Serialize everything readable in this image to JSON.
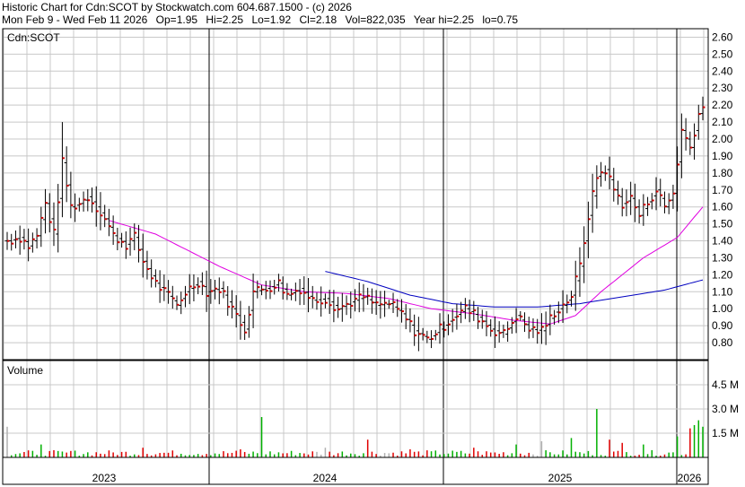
{
  "header": {
    "title": "Historic Chart for Cdn:SCOT by Stockwatch.com 604.687.1500 - (c) 2026",
    "date_range": "Mon Feb  9 - Wed Feb 11 2026",
    "stats": [
      "Op=1.95",
      "Hi=2.25",
      "Lo=1.92",
      "Cl=2.18",
      "Vol=822,035",
      "Year hi=2.25",
      "lo=0.75"
    ]
  },
  "colors": {
    "grid": "#c8c8c8",
    "bar": "#000000",
    "close_tick": "#d00000",
    "ma_short": "#e000e0",
    "ma_long": "#0000c0",
    "volume_up": "#00b000",
    "volume_down": "#e00000",
    "volume_flat": "#b0b0b0"
  },
  "chart_data": [
    {
      "type": "ohlc",
      "label": "Cdn:SCOT",
      "x_labels": [
        "2023",
        "2024",
        "2025",
        "2026"
      ],
      "ylim": [
        0.7,
        2.65
      ],
      "y_ticks": [
        "0.80",
        "0.90",
        "1.00",
        "1.10",
        "1.20",
        "1.30",
        "1.40",
        "1.50",
        "1.60",
        "1.70",
        "1.80",
        "1.90",
        "2.00",
        "2.10",
        "2.20",
        "2.30",
        "2.40",
        "2.50",
        "2.60"
      ],
      "grid": true,
      "bar_count": 165,
      "close_anchors": [
        [
          0,
          1.4
        ],
        [
          3,
          1.42
        ],
        [
          5,
          1.37
        ],
        [
          7,
          1.43
        ],
        [
          9,
          1.62
        ],
        [
          11,
          1.44
        ],
        [
          13,
          1.86
        ],
        [
          15,
          1.6
        ],
        [
          17,
          1.62
        ],
        [
          19,
          1.66
        ],
        [
          21,
          1.6
        ],
        [
          23,
          1.53
        ],
        [
          25,
          1.43
        ],
        [
          28,
          1.38
        ],
        [
          30,
          1.42
        ],
        [
          32,
          1.28
        ],
        [
          35,
          1.15
        ],
        [
          37,
          1.1
        ],
        [
          40,
          1.02
        ],
        [
          42,
          1.1
        ],
        [
          45,
          1.16
        ],
        [
          47,
          1.1
        ],
        [
          50,
          1.12
        ],
        [
          53,
          1.0
        ],
        [
          56,
          0.88
        ],
        [
          58,
          1.1
        ],
        [
          61,
          1.12
        ],
        [
          64,
          1.15
        ],
        [
          66,
          1.08
        ],
        [
          69,
          1.12
        ],
        [
          72,
          1.05
        ],
        [
          75,
          1.06
        ],
        [
          78,
          1.0
        ],
        [
          81,
          1.04
        ],
        [
          84,
          1.07
        ],
        [
          87,
          1.02
        ],
        [
          90,
          1.03
        ],
        [
          93,
          0.97
        ],
        [
          96,
          0.87
        ],
        [
          99,
          0.82
        ],
        [
          102,
          0.88
        ],
        [
          105,
          0.95
        ],
        [
          108,
          1.0
        ],
        [
          111,
          0.95
        ],
        [
          114,
          0.88
        ],
        [
          117,
          0.85
        ],
        [
          120,
          0.96
        ],
        [
          123,
          0.88
        ],
        [
          126,
          0.87
        ],
        [
          129,
          0.98
        ],
        [
          131,
          1.02
        ],
        [
          133,
          1.08
        ],
        [
          135,
          1.25
        ],
        [
          137,
          1.55
        ],
        [
          139,
          1.78
        ],
        [
          141,
          1.82
        ],
        [
          143,
          1.7
        ],
        [
          145,
          1.62
        ],
        [
          147,
          1.65
        ],
        [
          149,
          1.55
        ],
        [
          151,
          1.63
        ],
        [
          153,
          1.7
        ],
        [
          155,
          1.6
        ],
        [
          157,
          1.68
        ],
        [
          159,
          2.05
        ],
        [
          161,
          1.95
        ],
        [
          163,
          2.15
        ],
        [
          164,
          2.18
        ]
      ],
      "max_high": 2.25,
      "min_low": 0.75,
      "series": [
        {
          "name": "",
          "line": "short moving average",
          "start_bar": 24,
          "anchors": [
            [
              24,
              1.52
            ],
            [
              35,
              1.44
            ],
            [
              50,
              1.25
            ],
            [
              60,
              1.14
            ],
            [
              70,
              1.1
            ],
            [
              80,
              1.09
            ],
            [
              90,
              1.06
            ],
            [
              100,
              1.0
            ],
            [
              110,
              0.97
            ],
            [
              120,
              0.93
            ],
            [
              128,
              0.91
            ],
            [
              134,
              0.96
            ],
            [
              140,
              1.1
            ],
            [
              150,
              1.3
            ],
            [
              158,
              1.42
            ],
            [
              164,
              1.6
            ]
          ]
        },
        {
          "name": "",
          "line": "long moving average",
          "start_bar": 75,
          "anchors": [
            [
              75,
              1.22
            ],
            [
              85,
              1.16
            ],
            [
              95,
              1.08
            ],
            [
              105,
              1.03
            ],
            [
              115,
              1.01
            ],
            [
              125,
              1.01
            ],
            [
              135,
              1.03
            ],
            [
              145,
              1.07
            ],
            [
              155,
              1.11
            ],
            [
              164,
              1.17
            ]
          ]
        }
      ]
    },
    {
      "type": "bar",
      "label": "Volume",
      "y_ticks": [
        "1.5 M",
        "3.0 M",
        "4.5 M"
      ],
      "ylim": [
        0,
        6.0
      ],
      "unit": "M",
      "spikes": [
        [
          0,
          1.9
        ],
        [
          8,
          0.8
        ],
        [
          15,
          0.4
        ],
        [
          32,
          0.6
        ],
        [
          55,
          0.5
        ],
        [
          60,
          2.5
        ],
        [
          75,
          0.6
        ],
        [
          85,
          1.1
        ],
        [
          95,
          0.5
        ],
        [
          110,
          0.6
        ],
        [
          120,
          0.8
        ],
        [
          126,
          1.0
        ],
        [
          133,
          1.2
        ],
        [
          139,
          3.0
        ],
        [
          142,
          1.1
        ],
        [
          145,
          0.9
        ],
        [
          150,
          0.8
        ],
        [
          158,
          1.3
        ],
        [
          161,
          1.8
        ],
        [
          162,
          2.0
        ],
        [
          163,
          2.3
        ],
        [
          164,
          1.9
        ]
      ]
    }
  ]
}
